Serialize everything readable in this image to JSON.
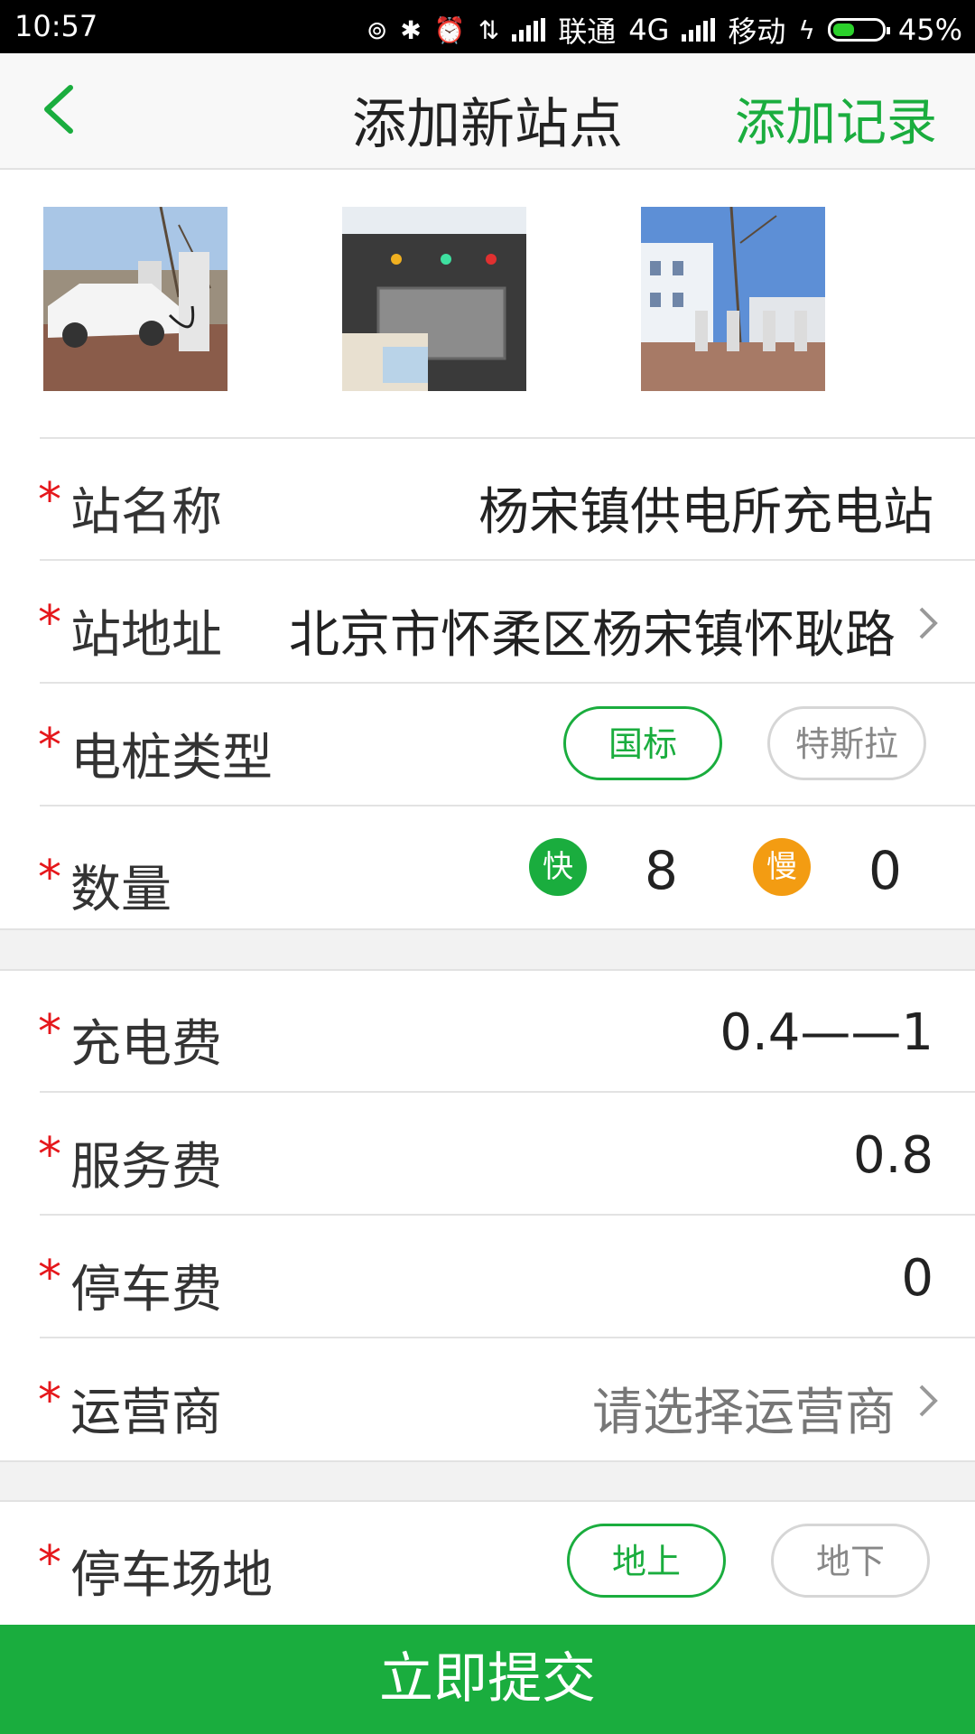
{
  "status_bar": {
    "time": "10:57",
    "carrier1": "联通",
    "network": "4G",
    "carrier2": "移动",
    "battery_percent": "45%",
    "battery_level": 0.45
  },
  "header": {
    "title": "添加新站点",
    "action": "添加记录",
    "back_icon": "chevron-left-icon"
  },
  "photos": [
    {
      "name": "charging-car-photo"
    },
    {
      "name": "charger-panel-photo"
    },
    {
      "name": "station-building-photo"
    }
  ],
  "required_mark": "*",
  "form": {
    "station_name": {
      "label": "站名称",
      "value": "杨宋镇供电所充电站"
    },
    "station_address": {
      "label": "站地址",
      "value": "北京市怀柔区杨宋镇怀耿路"
    },
    "pile_type": {
      "label": "电桩类型",
      "options": [
        "国标",
        "特斯拉"
      ],
      "selected": "国标"
    },
    "quantity": {
      "label": "数量",
      "fast_label": "快",
      "fast_count": "8",
      "slow_label": "慢",
      "slow_count": "0"
    },
    "charging_fee": {
      "label": "充电费",
      "value": "0.4——1"
    },
    "service_fee": {
      "label": "服务费",
      "value": "0.8"
    },
    "parking_fee": {
      "label": "停车费",
      "value": "0"
    },
    "operator": {
      "label": "运营商",
      "placeholder": "请选择运营商"
    },
    "parking_area": {
      "label": "停车场地",
      "options": [
        "地上",
        "地下"
      ],
      "selected": "地上"
    }
  },
  "submit_label": "立即提交",
  "colors": {
    "accent": "#1aad3e",
    "required": "#e5171b",
    "slow": "#f39c12"
  }
}
